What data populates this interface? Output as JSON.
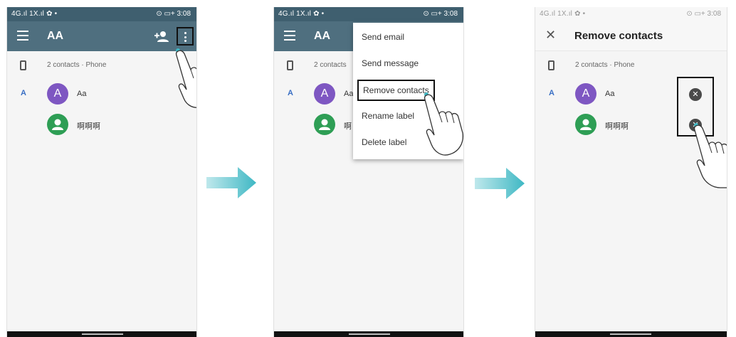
{
  "status": {
    "left": "4G.ıl 1X.ıl ✿ •",
    "right": "⊙ ▭+ 3:08"
  },
  "screen1": {
    "title": "AA",
    "contacts_count": "2 contacts · Phone",
    "section_letter": "A",
    "contacts": [
      {
        "avatar_letter": "A",
        "name": "Aa",
        "avatar_color": "#7e57c2"
      },
      {
        "avatar_letter": "",
        "name": "啊啊啊",
        "avatar_color": "#2e9e55"
      }
    ]
  },
  "screen2": {
    "title": "AA",
    "contacts_count": "2 contacts",
    "section_letter": "A",
    "contact_initial": "Aa",
    "contact_partial": "啊",
    "menu": [
      "Send email",
      "Send message",
      "Remove contacts",
      "Rename label",
      "Delete label"
    ]
  },
  "screen3": {
    "title": "Remove contacts",
    "contacts_count": "2 contacts · Phone",
    "section_letter": "A",
    "contacts": [
      {
        "avatar_letter": "A",
        "name": "Aa"
      },
      {
        "avatar_letter": "",
        "name": "啊啊啊"
      }
    ]
  },
  "colors": {
    "appbar": "#4f6f7f",
    "statusbar": "#3f5f6f",
    "arrow": "#3fb8c4",
    "accent_letter": "#3a6fc4"
  },
  "icons": {
    "menu": "hamburger-menu-icon",
    "add_person": "person-add-icon",
    "more": "more-vert-icon",
    "phone": "phone-icon",
    "close": "close-icon",
    "remove": "remove-circle-icon",
    "pointer": "hand-pointer-icon"
  }
}
